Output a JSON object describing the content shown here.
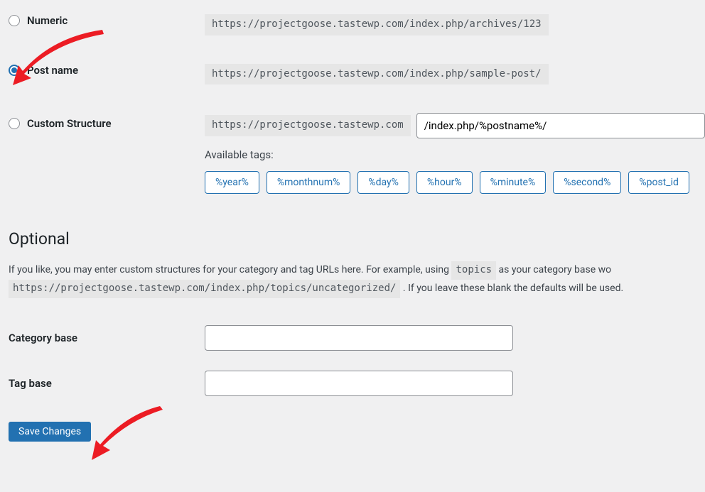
{
  "permalinks": {
    "numeric": {
      "label": "Numeric",
      "example": "https://projectgoose.tastewp.com/index.php/archives/123"
    },
    "postname": {
      "label": "Post name",
      "example": "https://projectgoose.tastewp.com/index.php/sample-post/"
    },
    "custom": {
      "label": "Custom Structure",
      "prefix": "https://projectgoose.tastewp.com",
      "value": "/index.php/%postname%/",
      "available_label": "Available tags:",
      "tags": [
        "%year%",
        "%monthnum%",
        "%day%",
        "%hour%",
        "%minute%",
        "%second%",
        "%post_id"
      ]
    },
    "selected": "postname"
  },
  "optional": {
    "heading": "Optional",
    "desc_pre": "If you like, you may enter custom structures for your category and tag URLs here. For example, using ",
    "desc_code1": "topics",
    "desc_mid": " as your category base wo",
    "desc_code2": "https://projectgoose.tastewp.com/index.php/topics/uncategorized/",
    "desc_post": " . If you leave these blank the defaults will be used.",
    "category_base": {
      "label": "Category base",
      "value": ""
    },
    "tag_base": {
      "label": "Tag base",
      "value": ""
    }
  },
  "actions": {
    "save_label": "Save Changes"
  }
}
